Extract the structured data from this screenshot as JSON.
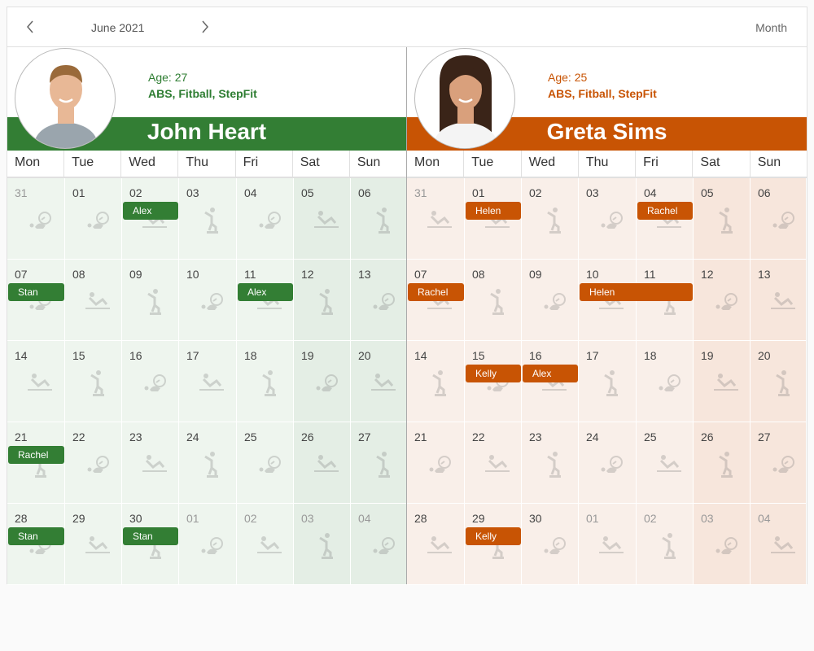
{
  "toolbar": {
    "prev_icon": "chevron-left-icon",
    "next_icon": "chevron-right-icon",
    "period_label": "June 2021",
    "view_label": "Month"
  },
  "weekdays": [
    "Mon",
    "Tue",
    "Wed",
    "Thu",
    "Fri",
    "Sat",
    "Sun"
  ],
  "resources": [
    {
      "name": "John Heart",
      "age_label": "Age: 27",
      "skills": "ABS, Fitball, StepFit",
      "color": "#337e34",
      "accent_text": "#2e7d32",
      "cell_bg": "#eef5ee",
      "weekend_bg": "#e4eee5",
      "avatar": "male-avatar-icon",
      "weeks": [
        [
          "31",
          "01",
          "02",
          "03",
          "04",
          "05",
          "06"
        ],
        [
          "07",
          "08",
          "09",
          "10",
          "11",
          "12",
          "13"
        ],
        [
          "14",
          "15",
          "16",
          "17",
          "18",
          "19",
          "20"
        ],
        [
          "21",
          "22",
          "23",
          "24",
          "25",
          "26",
          "27"
        ],
        [
          "28",
          "29",
          "30",
          "01",
          "02",
          "03",
          "04"
        ]
      ],
      "other_month": [
        [
          0,
          0
        ],
        [
          4,
          3
        ],
        [
          4,
          4
        ],
        [
          4,
          5
        ],
        [
          4,
          6
        ]
      ],
      "icons": [
        [
          "fitball-icon",
          "fitball-icon",
          "abs-icon",
          "stepfit-icon",
          "fitball-icon",
          "abs-icon",
          "stepfit-icon"
        ],
        [
          "fitball-icon",
          "abs-icon",
          "stepfit-icon",
          "fitball-icon",
          "abs-icon",
          "stepfit-icon",
          "fitball-icon"
        ],
        [
          "abs-icon",
          "stepfit-icon",
          "fitball-icon",
          "abs-icon",
          "stepfit-icon",
          "fitball-icon",
          "abs-icon"
        ],
        [
          "stepfit-icon",
          "fitball-icon",
          "abs-icon",
          "stepfit-icon",
          "fitball-icon",
          "abs-icon",
          "stepfit-icon"
        ],
        [
          "fitball-icon",
          "abs-icon",
          "stepfit-icon",
          "fitball-icon",
          "abs-icon",
          "stepfit-icon",
          "fitball-icon"
        ]
      ],
      "events": [
        {
          "text": "Alex",
          "week": 0,
          "day": 2,
          "span": 1
        },
        {
          "text": "Stan",
          "week": 1,
          "day": 0,
          "span": 1
        },
        {
          "text": "Alex",
          "week": 1,
          "day": 4,
          "span": 1
        },
        {
          "text": "Rachel",
          "week": 3,
          "day": 0,
          "span": 1
        },
        {
          "text": "Stan",
          "week": 4,
          "day": 0,
          "span": 1
        },
        {
          "text": "Stan",
          "week": 4,
          "day": 2,
          "span": 1
        }
      ]
    },
    {
      "name": "Greta Sims",
      "age_label": "Age: 25",
      "skills": "ABS, Fitball, StepFit",
      "color": "#c85404",
      "accent_text": "#c85404",
      "cell_bg": "#f9efe9",
      "weekend_bg": "#f7e6dc",
      "avatar": "female-avatar-icon",
      "weeks": [
        [
          "31",
          "01",
          "02",
          "03",
          "04",
          "05",
          "06"
        ],
        [
          "07",
          "08",
          "09",
          "10",
          "11",
          "12",
          "13"
        ],
        [
          "14",
          "15",
          "16",
          "17",
          "18",
          "19",
          "20"
        ],
        [
          "21",
          "22",
          "23",
          "24",
          "25",
          "26",
          "27"
        ],
        [
          "28",
          "29",
          "30",
          "01",
          "02",
          "03",
          "04"
        ]
      ],
      "other_month": [
        [
          0,
          0
        ],
        [
          4,
          3
        ],
        [
          4,
          4
        ],
        [
          4,
          5
        ],
        [
          4,
          6
        ]
      ],
      "icons": [
        [
          "abs-icon",
          "abs-icon",
          "stepfit-icon",
          "fitball-icon",
          "abs-icon",
          "stepfit-icon",
          "fitball-icon"
        ],
        [
          "abs-icon",
          "stepfit-icon",
          "fitball-icon",
          "abs-icon",
          "stepfit-icon",
          "fitball-icon",
          "abs-icon"
        ],
        [
          "stepfit-icon",
          "fitball-icon",
          "abs-icon",
          "stepfit-icon",
          "fitball-icon",
          "abs-icon",
          "stepfit-icon"
        ],
        [
          "fitball-icon",
          "abs-icon",
          "stepfit-icon",
          "fitball-icon",
          "abs-icon",
          "stepfit-icon",
          "fitball-icon"
        ],
        [
          "abs-icon",
          "stepfit-icon",
          "fitball-icon",
          "abs-icon",
          "stepfit-icon",
          "fitball-icon",
          "abs-icon"
        ]
      ],
      "events": [
        {
          "text": "Helen",
          "week": 0,
          "day": 1,
          "span": 1
        },
        {
          "text": "Rachel",
          "week": 0,
          "day": 4,
          "span": 1
        },
        {
          "text": "Rachel",
          "week": 1,
          "day": 0,
          "span": 1
        },
        {
          "text": "Helen",
          "week": 1,
          "day": 3,
          "span": 2
        },
        {
          "text": "Kelly",
          "week": 2,
          "day": 1,
          "span": 1
        },
        {
          "text": "Alex",
          "week": 2,
          "day": 2,
          "span": 1
        },
        {
          "text": "Kelly",
          "week": 4,
          "day": 1,
          "span": 1
        }
      ]
    }
  ]
}
